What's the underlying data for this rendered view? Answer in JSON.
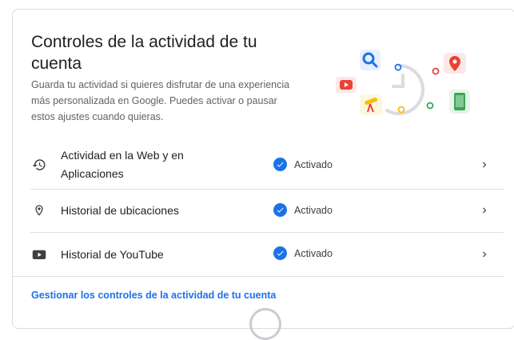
{
  "card": {
    "title": "Controles de la actividad de tu cuenta",
    "description": "Guarda tu actividad si quieres disfrutar de una experiencia más personalizada en Google. Puedes activar o pausar estos ajustes cuando quieras."
  },
  "settings": [
    {
      "label": "Actividad en la Web y en Aplicaciones",
      "status": "Activado",
      "icon": "history-icon"
    },
    {
      "label": "Historial de ubicaciones",
      "status": "Activado",
      "icon": "location-pin-icon"
    },
    {
      "label": "Historial de YouTube",
      "status": "Activado",
      "icon": "youtube-icon"
    }
  ],
  "footer": {
    "manage_link": "Gestionar los controles de la actividad de tu cuenta"
  },
  "colors": {
    "accent": "#1a73e8",
    "text_primary": "#202124",
    "text_secondary": "#5f6368",
    "divider": "#e0e0e0"
  }
}
